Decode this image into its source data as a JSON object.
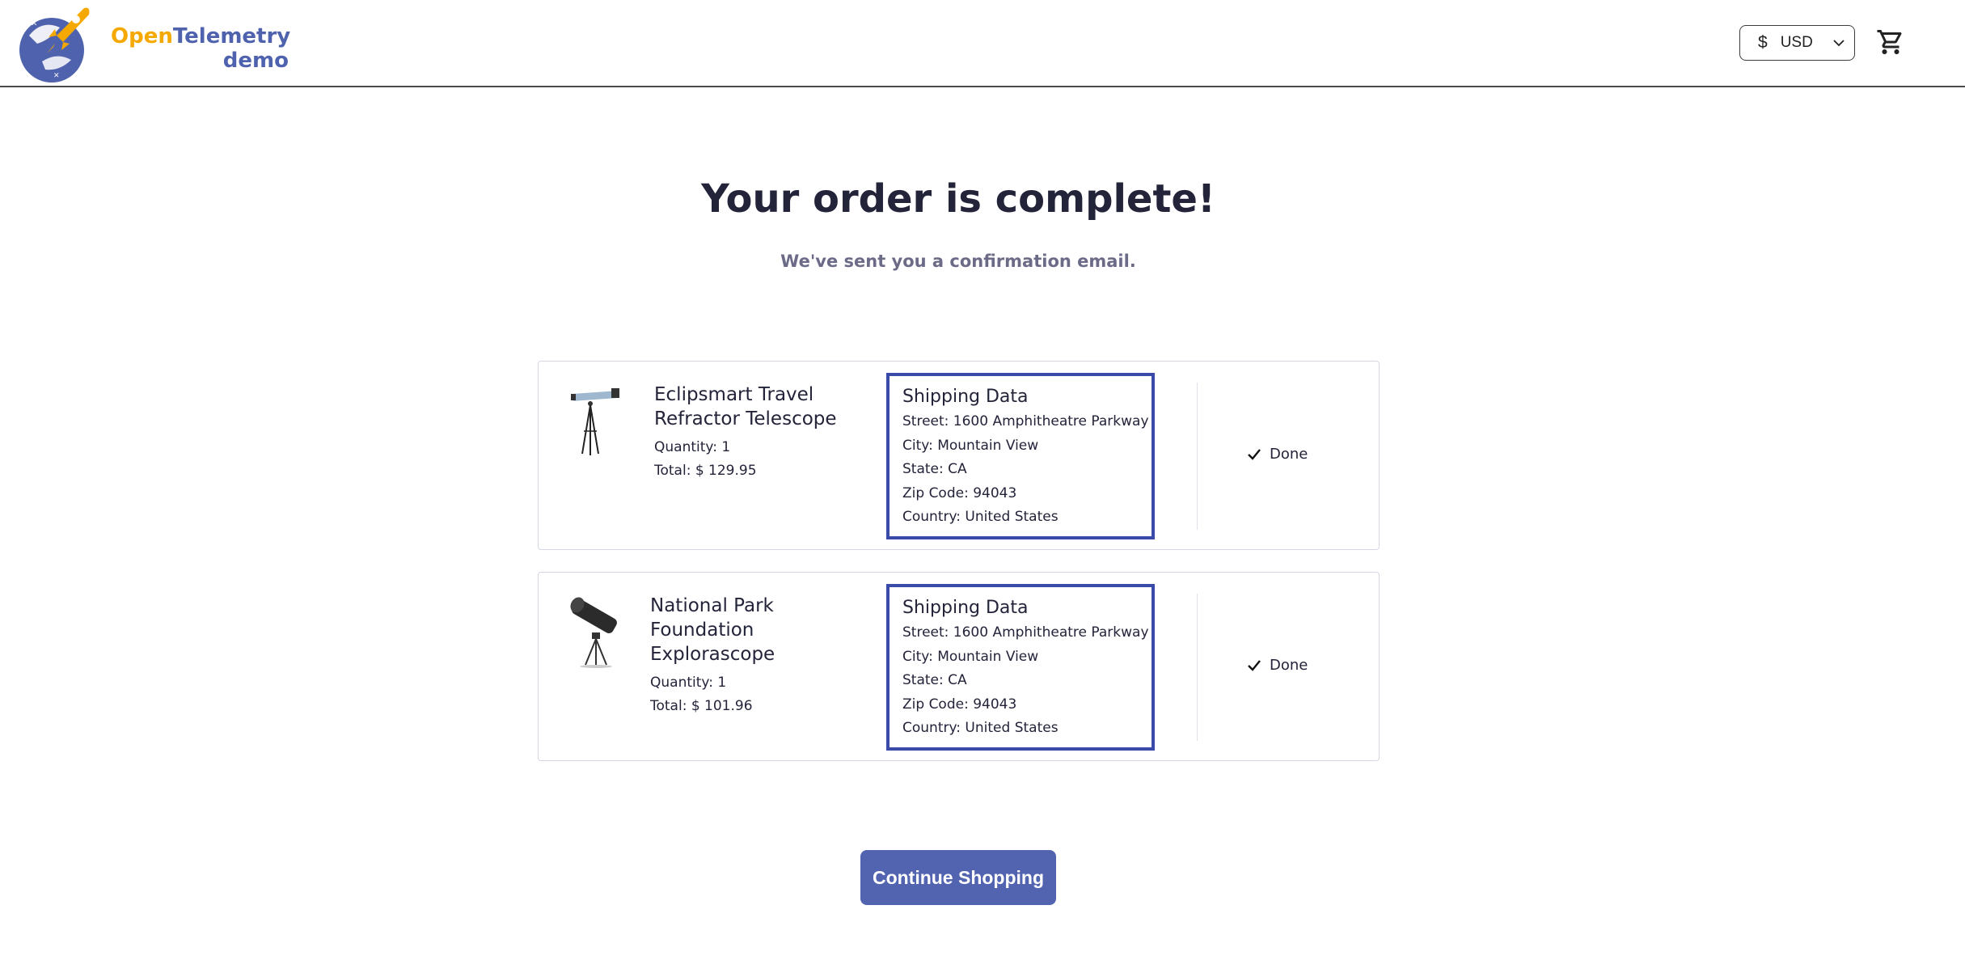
{
  "header": {
    "logo": {
      "brand_open": "Open",
      "brand_telemetry": "Telemetry",
      "brand_demo": "demo"
    },
    "currency": {
      "symbol": "$",
      "code": "USD"
    },
    "cart_icon": "shopping-cart-icon"
  },
  "main": {
    "title": "Your order is complete!",
    "subtitle": "We've sent you a confirmation email.",
    "orders": [
      {
        "name": "Eclipsmart Travel Refractor Telescope",
        "quantity": "Quantity: 1",
        "total": "Total: $ 129.95",
        "shipping": {
          "title": "Shipping Data",
          "street": "Street: 1600 Amphitheatre Parkway",
          "city": "City: Mountain View",
          "state": "State: CA",
          "zip": "Zip Code: 94043",
          "country": "Country: United States"
        },
        "status": "Done"
      },
      {
        "name": "National Park Foundation Explorascope",
        "quantity": "Quantity: 1",
        "total": "Total: $ 101.96",
        "shipping": {
          "title": "Shipping Data",
          "street": "Street: 1600 Amphitheatre Parkway",
          "city": "City: Mountain View",
          "state": "State: CA",
          "zip": "Zip Code: 94043",
          "country": "Country: United States"
        },
        "status": "Done"
      }
    ],
    "continue_label": "Continue Shopping"
  },
  "colors": {
    "brand_orange": "#f5a800",
    "brand_blue": "#4f62ad",
    "shipping_border": "#3a4aa8",
    "button_bg": "#5264b0"
  }
}
